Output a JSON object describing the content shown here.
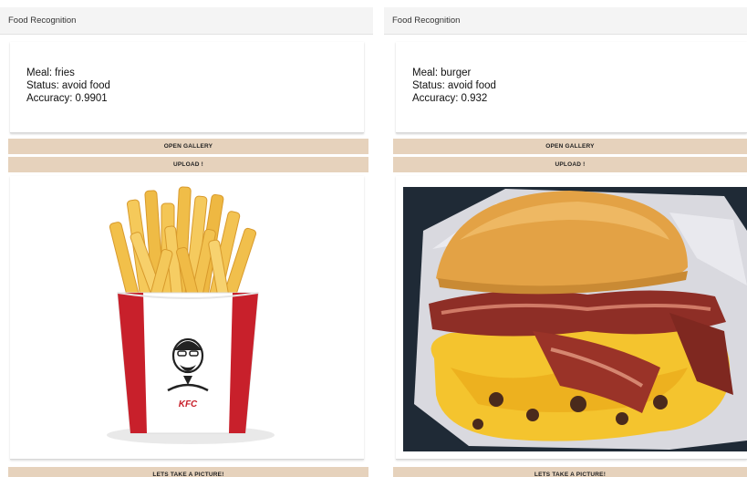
{
  "screens": [
    {
      "app_title": "Food Recognition",
      "result": {
        "meal_label": "Meal:",
        "meal": "fries",
        "status_label": "Status:",
        "status": "avoid food",
        "accuracy_label": "Accuracy:",
        "accuracy": "0.9901"
      },
      "buttons": {
        "open_gallery": "OPEN GALLERY",
        "upload": "UPLOAD !",
        "take_picture": "LETS TAKE A PICTURE!"
      },
      "photo": {
        "subject": "french-fries",
        "carton_brand": "KFC"
      }
    },
    {
      "app_title": "Food Recognition",
      "result": {
        "meal_label": "Meal:",
        "meal": "burger",
        "status_label": "Status:",
        "status": "avoid food",
        "accuracy_label": "Accuracy:",
        "accuracy": "0.932"
      },
      "buttons": {
        "open_gallery": "OPEN GALLERY",
        "upload": "UPLOAD !",
        "take_picture": "LETS TAKE A PICTURE!"
      },
      "photo": {
        "subject": "bacon-cheeseburger"
      }
    }
  ],
  "colors": {
    "button_bg": "#e6d2bc",
    "appbar_bg": "#f4f4f4",
    "carton_red": "#c8202b",
    "fries_yellow": "#f2c04a",
    "bun": "#e3a245",
    "cheese": "#f4c42e",
    "bacon": "#8e2e26",
    "photo_bg": "#1f2a36"
  }
}
